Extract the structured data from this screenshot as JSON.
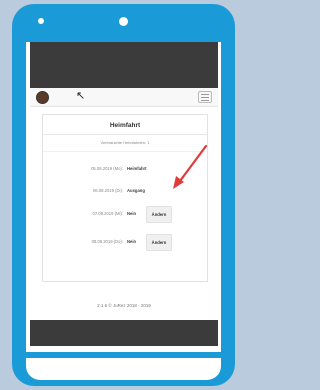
{
  "app": {
    "title": "Heimfahrt",
    "subtitle": "Verbrauchte Heimfahrten: 1"
  },
  "rows": [
    {
      "date": "05.08.2019 (Mo):",
      "status": "Heimfahrt",
      "button": ""
    },
    {
      "date": "06.08.2019 (Di):",
      "status": "Ausgang",
      "button": ""
    },
    {
      "date": "07.08.2019 (Mi):",
      "status": "Nein",
      "button": "Ändern"
    },
    {
      "date": "08.08.2019 (Do):",
      "status": "Nein",
      "button": "Ändern"
    }
  ],
  "footer": "2.1.6 © JuRez 2018 - 2019",
  "colors": {
    "device_frame": "#1a9bd7",
    "background": "#b9cbdc",
    "annotation_arrow": "#e03a3a"
  },
  "icons": {
    "logo": "app-logo",
    "menu": "hamburger-menu-icon",
    "cursor": "mouse-cursor-icon",
    "annotation": "red-arrow"
  }
}
